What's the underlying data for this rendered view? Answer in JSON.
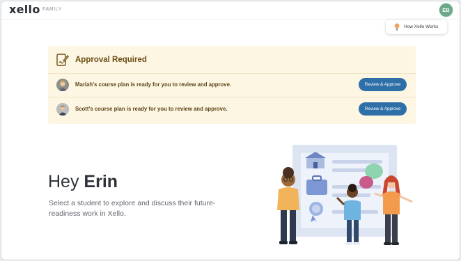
{
  "header": {
    "logo": "xello",
    "section_label": "FAMILY",
    "user_initials": "EB",
    "help_button_label": "How Xello Works"
  },
  "approval": {
    "title": "Approval Required",
    "items": [
      {
        "message": "Mariah's course plan is ready for you to review and approve.",
        "button_label": "Review & Approve"
      },
      {
        "message": "Scott's course plan is ready for you to review and approve.",
        "button_label": "Review & Approve"
      }
    ]
  },
  "welcome": {
    "greeting": "Hey",
    "name": "Erin",
    "subtitle": "Select a student to explore and discuss their future-readiness work in Xello."
  },
  "colors": {
    "accent_button": "#2f6fa8",
    "approval_bg": "#fdf6e3",
    "approval_text": "#6b4e13",
    "avatar_bg": "#6ba88a"
  }
}
